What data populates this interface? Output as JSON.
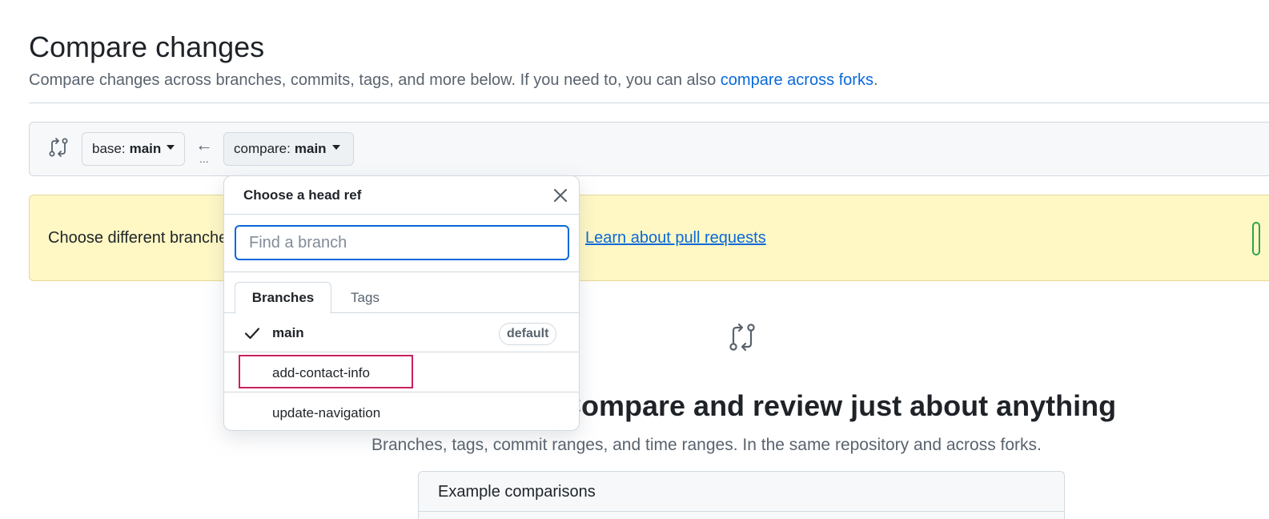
{
  "header": {
    "title": "Compare changes",
    "subtitle": "Compare changes across branches, commits, tags, and more below. If you need to, you can also ",
    "subtitle_link": "compare across forks",
    "subtitle_end": "."
  },
  "range": {
    "base_prefix": "base:",
    "base_value": "main",
    "compare_prefix": "compare:",
    "compare_value": "main",
    "arrow": "←",
    "dots": "..."
  },
  "flash": {
    "text": "Choose different branches or forks above to discuss and review changes.",
    "link": "Learn about pull requests"
  },
  "blankslate": {
    "title": "Compare and review just about anything",
    "subtitle": "Branches, tags, commit ranges, and time ranges. In the same repository and across forks.",
    "examples_title": "Example comparisons"
  },
  "dropdown": {
    "title": "Choose a head ref",
    "filter_placeholder": "Find a branch",
    "filter_value": "",
    "tabs": [
      {
        "label": "Branches",
        "active": true
      },
      {
        "label": "Tags",
        "active": false
      }
    ],
    "items": [
      {
        "label": "main",
        "selected": true,
        "badge": "default"
      },
      {
        "label": "add-contact-info",
        "selected": false,
        "highlighted": true
      },
      {
        "label": "update-navigation",
        "selected": false
      }
    ]
  },
  "colors": {
    "link": "#0969da",
    "flash_bg": "#fff8c5",
    "highlight": "#c8215e",
    "border": "#d1d9e0"
  },
  "icons": [
    "git-compare-icon",
    "arrow-left-icon",
    "caret-down-icon",
    "close-icon",
    "check-icon"
  ]
}
